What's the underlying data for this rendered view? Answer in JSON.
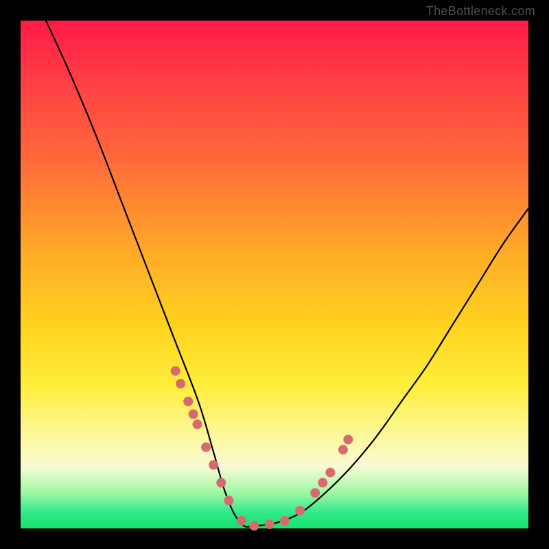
{
  "watermark": "TheBottleneck.com",
  "chart_data": {
    "type": "line",
    "title": "",
    "xlabel": "",
    "ylabel": "",
    "xlim": [
      0,
      100
    ],
    "ylim": [
      0,
      100
    ],
    "grid": false,
    "legend": false,
    "series": [
      {
        "name": "bottleneck-curve",
        "x": [
          5,
          10,
          15,
          20,
          25,
          30,
          35,
          38,
          40,
          42,
          44,
          46,
          50,
          55,
          60,
          65,
          70,
          75,
          80,
          85,
          90,
          95,
          100
        ],
        "y": [
          100,
          89,
          77,
          64,
          51,
          38,
          25,
          15,
          8,
          3,
          0.5,
          0.5,
          1,
          3,
          7,
          12,
          18,
          25,
          32,
          40,
          48,
          56,
          63
        ]
      }
    ],
    "markers": {
      "name": "sample-points",
      "color": "#d86a6f",
      "x": [
        30.5,
        31.5,
        33,
        34,
        34.8,
        36.5,
        38,
        39.5,
        41,
        43.5,
        46,
        49,
        52,
        55,
        58,
        59.5,
        61,
        63.5,
        64.5
      ],
      "y": [
        31,
        28.5,
        25,
        22.5,
        20.5,
        16,
        12.5,
        9,
        5.5,
        1.5,
        0.5,
        0.8,
        1.5,
        3.5,
        7,
        9,
        11,
        15.5,
        17.5
      ]
    },
    "background_gradient": {
      "top": "#ff1a46",
      "mid1": "#ffa828",
      "mid2": "#ffee3a",
      "bottom": "#16e36b"
    }
  }
}
